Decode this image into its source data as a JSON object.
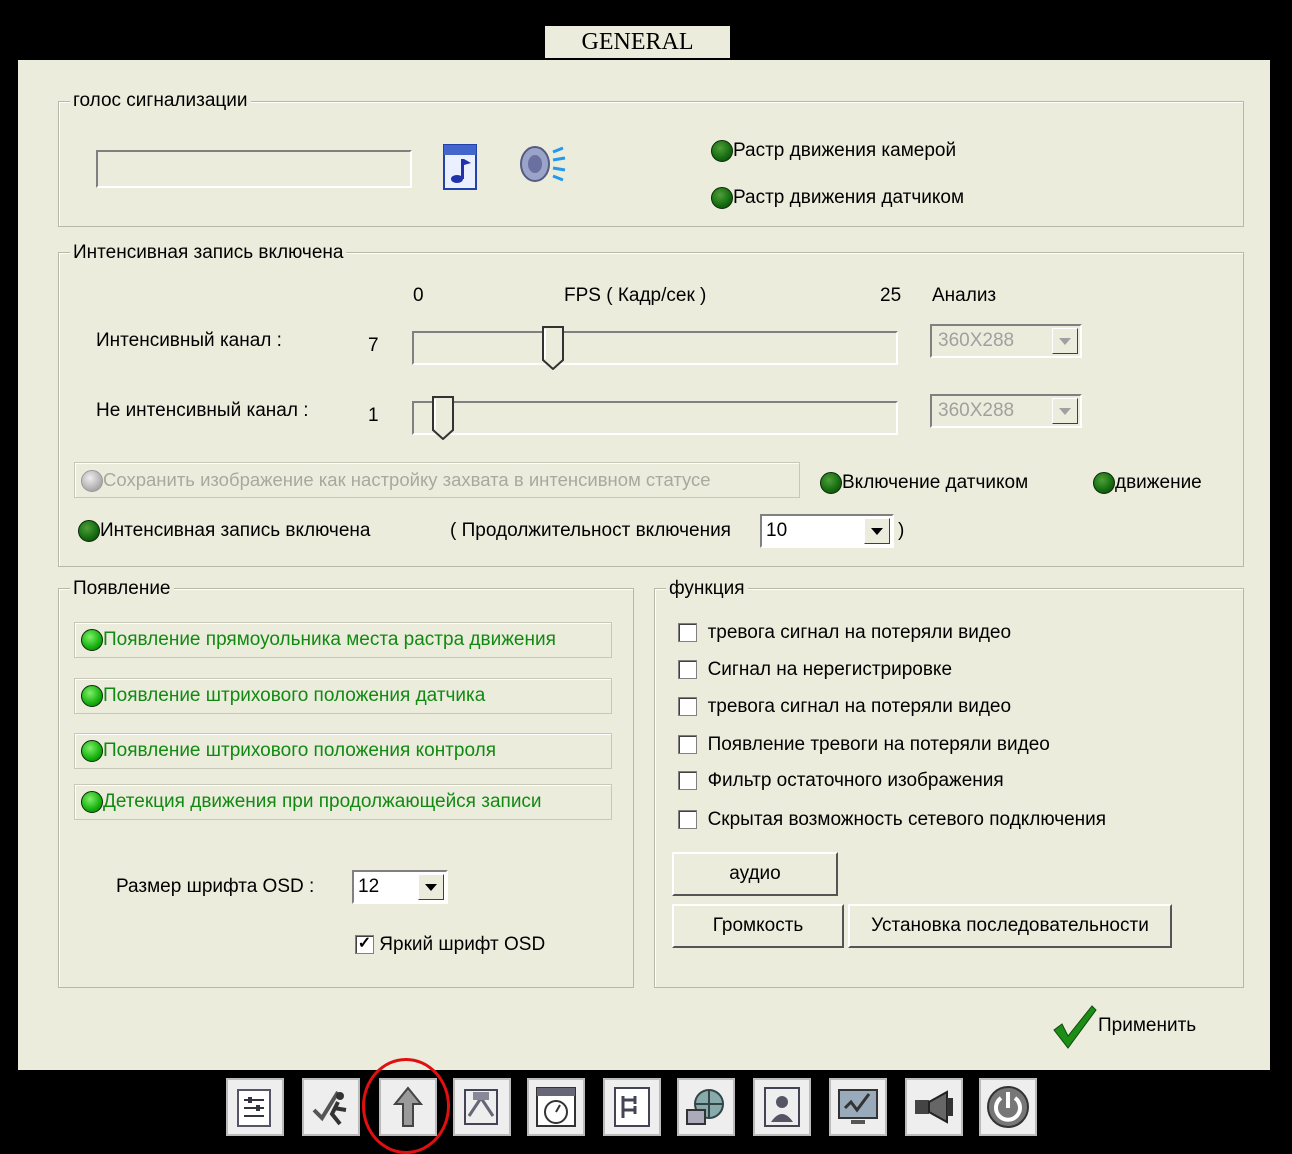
{
  "window": {
    "title": "GENERAL"
  },
  "alarm_voice": {
    "legend": "голос сигнализации",
    "file_value": "",
    "options": [
      "Растр движения камерой",
      "Растр движения датчиком"
    ]
  },
  "intensive": {
    "legend": "Интенсивная запись включена",
    "fps_min": "0",
    "fps_label": "FPS ( Кадр/сек )",
    "fps_max": "25",
    "analysis_label": "Анализ",
    "channel_label": "Интенсивный канал :",
    "channel_value": "7",
    "channel_fraction": 0.28,
    "channel_resolution": "360X288",
    "non_channel_label": "Не интенсивный канал :",
    "non_channel_value": "1",
    "non_channel_fraction": 0.04,
    "non_channel_resolution": "360X288",
    "save_capture_label": "Сохранить изображение как настройку захвата в интенсивном статусе",
    "sensor_label": "Включение датчиком",
    "motion_label": "движение",
    "record_on_label": "Интенсивная запись включена",
    "duration_label_open": "( Продолжительност включения",
    "duration_value": "10",
    "duration_label_close": ")"
  },
  "appearance": {
    "legend": "Появление",
    "items": [
      "Появление прямоуольника места растра движения",
      "Появление штрихового положения датчика",
      "Появление штрихового положения контроля",
      "Детекция движения при продолжающейся записи"
    ],
    "osd_size_label": "Размер шрифта OSD :",
    "osd_size_value": "12",
    "bright_osd_label": "Яркий шрифт OSD",
    "bright_osd_checked": true
  },
  "function": {
    "legend": "функция",
    "items": [
      "тревога сигнал на потеряли видео",
      "Сигнал на нерегистрировке",
      "тревога сигнал на потеряли видео",
      "Появление тревоги на потеряли видео",
      "Фильтр остаточного изображения",
      "Скрытая возможность сетевого подключения"
    ],
    "audio_button": "аудио",
    "volume_button": "Громкость",
    "sequence_button": "Установка последовательности"
  },
  "apply_label": "Применить",
  "toolbar_icons": [
    "settings-icon",
    "runner-icon",
    "upload-icon",
    "record-icon",
    "clock-icon",
    "schedule-icon",
    "network-icon",
    "user-icon",
    "monitor-icon",
    "camera-icon",
    "power-icon"
  ],
  "colors": {
    "panel": "#ececdd",
    "green_text": "#118a11",
    "highlight_circle": "#e01010"
  }
}
